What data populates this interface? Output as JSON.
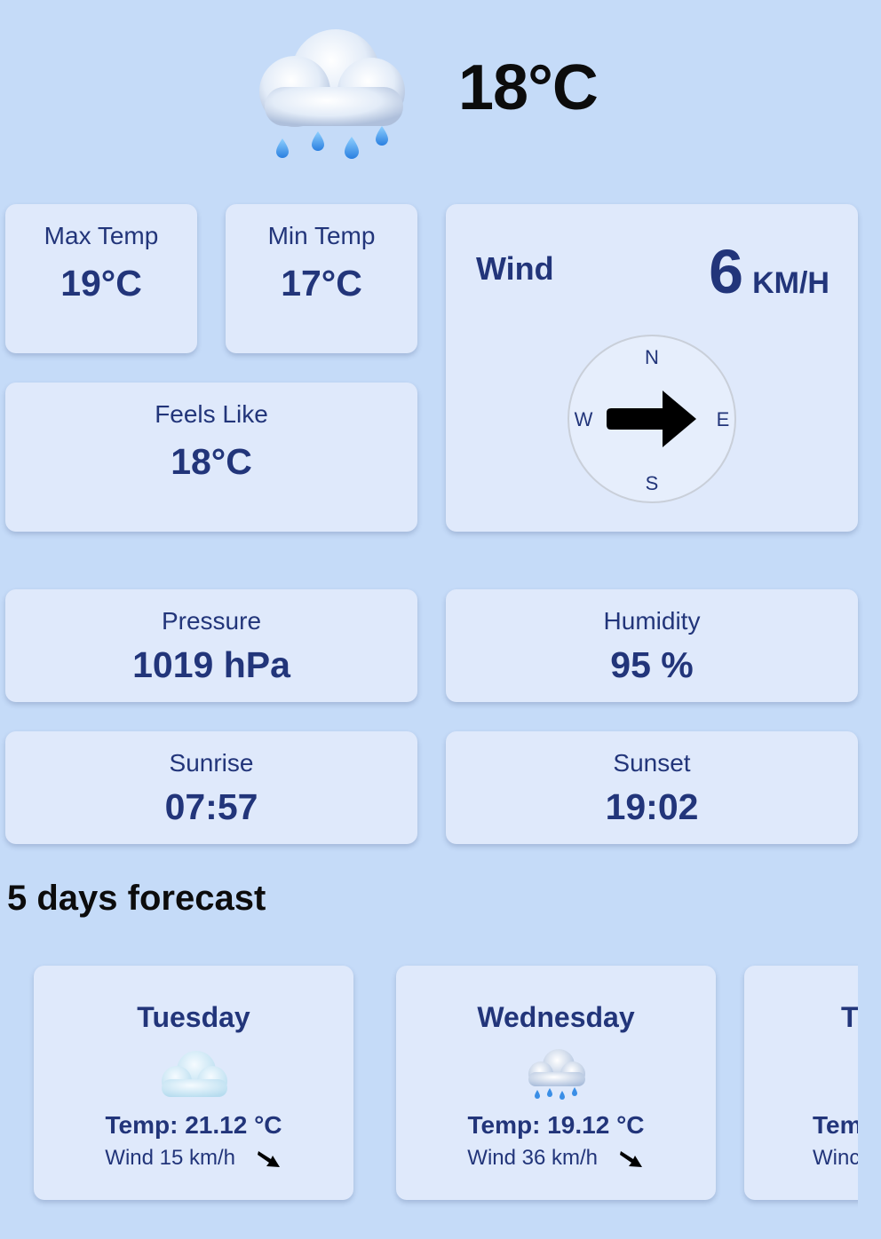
{
  "current": {
    "icon": "rain-cloud-icon",
    "temperature": "18°C"
  },
  "stats": {
    "max_temp": {
      "label": "Max Temp",
      "value": "19°C"
    },
    "min_temp": {
      "label": "Min Temp",
      "value": "17°C"
    },
    "feels_like": {
      "label": "Feels Like",
      "value": "18°C"
    },
    "pressure": {
      "label": "Pressure",
      "value": "1019 hPa"
    },
    "humidity": {
      "label": "Humidity",
      "value": "95 %"
    },
    "sunrise": {
      "label": "Sunrise",
      "value": "07:57"
    },
    "sunset": {
      "label": "Sunset",
      "value": "19:02"
    }
  },
  "wind": {
    "label": "Wind",
    "speed": "6",
    "unit": "KM/H",
    "compass": {
      "n": "N",
      "e": "E",
      "s": "S",
      "w": "W"
    },
    "direction_icon": "arrow-right-icon"
  },
  "forecast": {
    "heading": "5 days forecast",
    "days": [
      {
        "day": "Tuesday",
        "icon": "cloud-icon",
        "temp": "Temp: 21.12 °C",
        "wind": "Wind 15 km/h",
        "wind_icon": "arrow-down-right-icon"
      },
      {
        "day": "Wednesday",
        "icon": "rain-cloud-icon",
        "temp": "Temp: 19.12 °C",
        "wind": "Wind 36 km/h",
        "wind_icon": "arrow-down-right-icon"
      },
      {
        "day": "T",
        "icon": "",
        "temp": "Tem",
        "wind": "Winc",
        "wind_icon": ""
      }
    ]
  },
  "colors": {
    "background": "#c5dbf8",
    "card": "#dfe9fb",
    "text": "#22357a",
    "heading": "#0c0c0c"
  }
}
